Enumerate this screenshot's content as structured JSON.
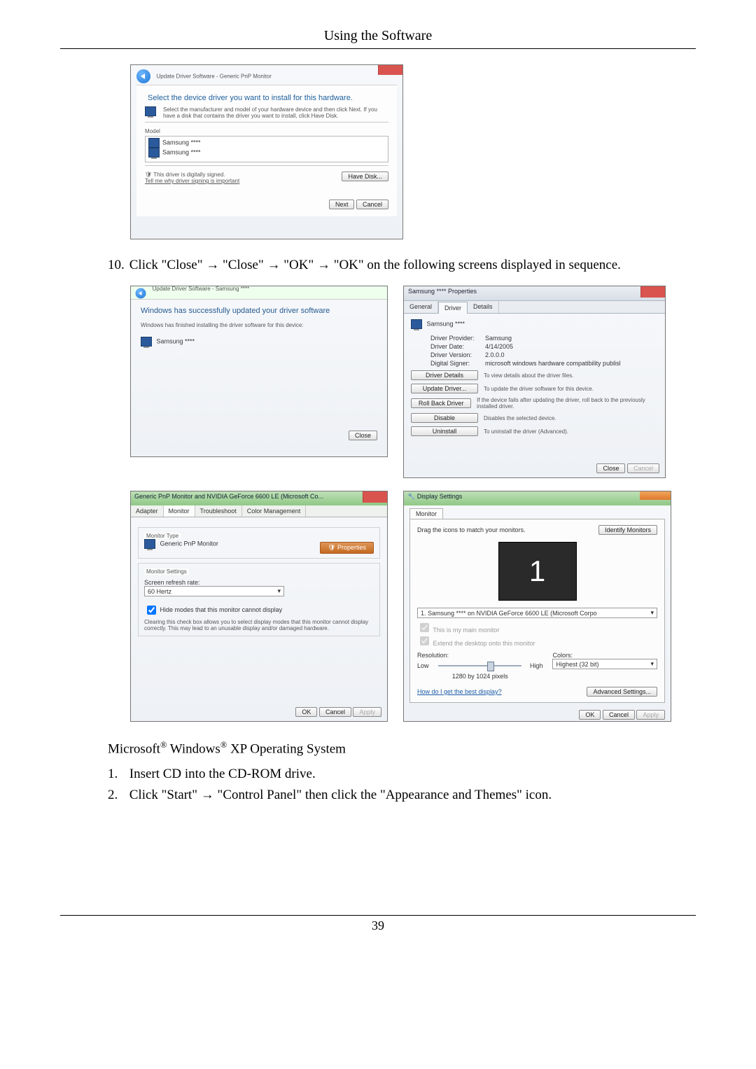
{
  "header": "Using the Software",
  "page_number": "39",
  "screenshot1": {
    "breadcrumb": "Update Driver Software - Generic PnP Monitor",
    "heading": "Select the device driver you want to install for this hardware.",
    "hint": "Select the manufacturer and model of your hardware device and then click Next. If you have a disk that contains the driver you want to install, click Have Disk.",
    "model_label": "Model",
    "model1": "Samsung ****",
    "model2": "Samsung ****",
    "signed": "This driver is digitally signed.",
    "tell": "Tell me why driver signing is important",
    "have_disk": "Have Disk...",
    "next": "Next",
    "cancel": "Cancel"
  },
  "step10": {
    "num": "10.",
    "text": "Click \"Close\" → \"Close\" → \"OK\" → \"OK\" on the following screens displayed in sequence."
  },
  "s2": {
    "breadcrumb": "Update Driver Software - Samsung ****",
    "line1": "Windows has successfully updated your driver software",
    "line2": "Windows has finished installing the driver software for this device:",
    "dev": "Samsung ****",
    "close": "Close"
  },
  "s3": {
    "title": "Samsung **** Properties",
    "tab_general": "General",
    "tab_driver": "Driver",
    "tab_details": "Details",
    "dev": "Samsung ****",
    "k_provider": "Driver Provider:",
    "v_provider": "Samsung",
    "k_date": "Driver Date:",
    "v_date": "4/14/2005",
    "k_ver": "Driver Version:",
    "v_ver": "2.0.0.0",
    "k_sig": "Digital Signer:",
    "v_sig": "microsoft windows hardware compatibility publisl",
    "b_details": "Driver Details",
    "d_details": "To view details about the driver files.",
    "b_update": "Update Driver...",
    "d_update": "To update the driver software for this device.",
    "b_roll": "Roll Back Driver",
    "d_roll": "If the device fails after updating the driver, roll back to the previously installed driver.",
    "b_disable": "Disable",
    "d_disable": "Disables the selected device.",
    "b_uninst": "Uninstall",
    "d_uninst": "To uninstall the driver (Advanced).",
    "close": "Close",
    "cancel": "Cancel"
  },
  "s4": {
    "title": "Generic PnP Monitor and NVIDIA GeForce 6600 LE (Microsoft Co...",
    "tab_adapter": "Adapter",
    "tab_monitor": "Monitor",
    "tab_trouble": "Troubleshoot",
    "tab_color": "Color Management",
    "mtype_lbl": "Monitor Type",
    "mtype_val": "Generic PnP Monitor",
    "props": "Properties",
    "ms_lbl": "Monitor Settings",
    "rate_lbl": "Screen refresh rate:",
    "rate_val": "60 Hertz",
    "hide": "Hide modes that this monitor cannot display",
    "hide_desc": "Clearing this check box allows you to select display modes that this monitor cannot display correctly. This may lead to an unusable display and/or damaged hardware.",
    "ok": "OK",
    "cancel": "Cancel",
    "apply": "Apply"
  },
  "s5": {
    "title": "Display Settings",
    "tab": "Monitor",
    "drag": "Drag the icons to match your monitors.",
    "ident": "Identify Monitors",
    "big1": "1",
    "dd": "1. Samsung **** on NVIDIA GeForce 6600 LE (Microsoft Corpo",
    "main": "This is my main monitor",
    "extend": "Extend the desktop onto this monitor",
    "res_lbl": "Resolution:",
    "low": "Low",
    "high": "High",
    "res_val": "1280 by 1024 pixels",
    "col_lbl": "Colors:",
    "col_val": "Highest (32 bit)",
    "best": "How do I get the best display?",
    "adv": "Advanced Settings...",
    "ok": "OK",
    "cancel": "Cancel",
    "apply": "Apply"
  },
  "xp": {
    "heading_pre": "Microsoft",
    "heading_mid": " Windows",
    "heading_post": " XP Operating System",
    "step1_num": "1.",
    "step1_text": "Insert CD into the CD-ROM drive.",
    "step2_num": "2.",
    "step2_text": "Click \"Start\" → \"Control Panel\" then click the \"Appearance and Themes\" icon."
  }
}
